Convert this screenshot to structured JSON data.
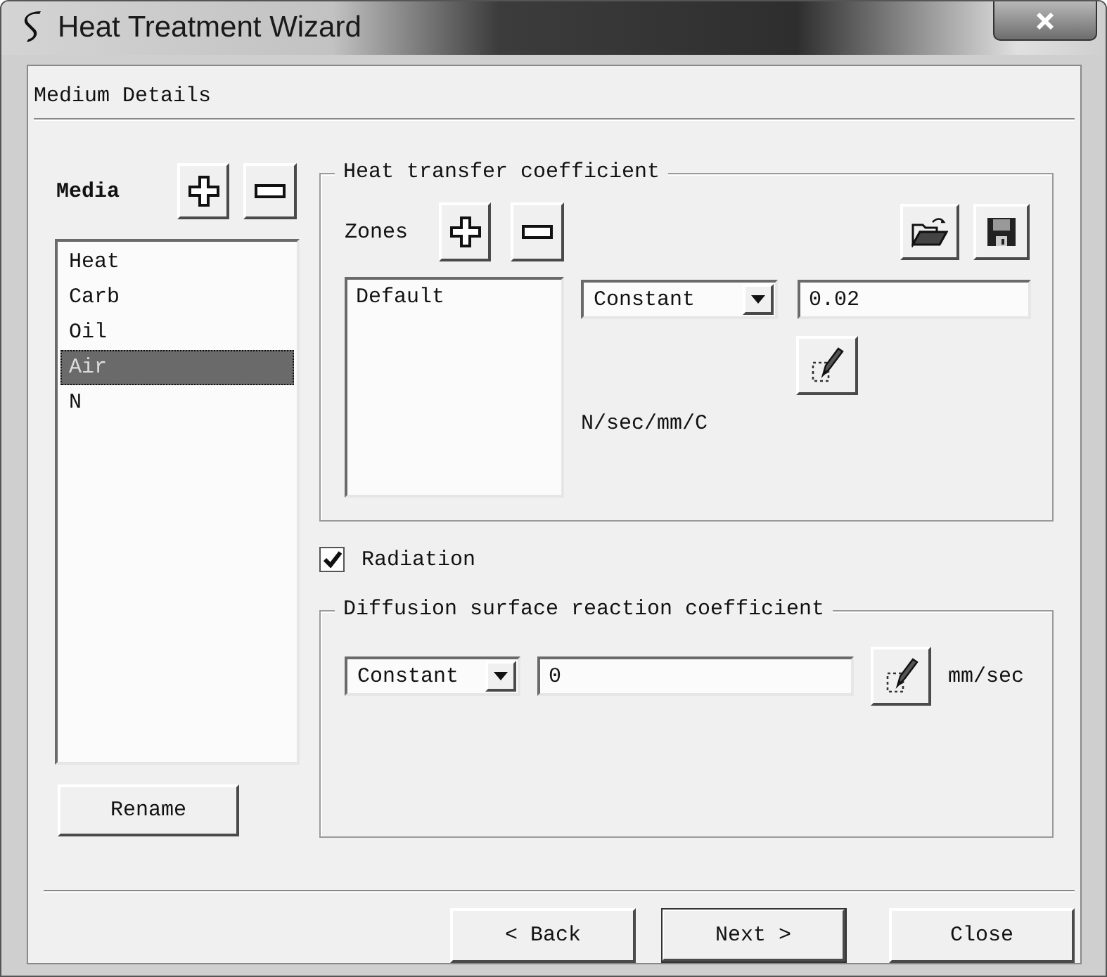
{
  "window": {
    "title": "Heat Treatment Wizard"
  },
  "page_title": "Medium Details",
  "media": {
    "label": "Media",
    "items": [
      {
        "label": "Heat",
        "selected": false
      },
      {
        "label": "Carb",
        "selected": false
      },
      {
        "label": "Oil",
        "selected": false
      },
      {
        "label": "Air",
        "selected": true
      },
      {
        "label": "N",
        "selected": false
      }
    ],
    "rename": "Rename"
  },
  "heat_transfer": {
    "title": "Heat transfer coefficient",
    "zones_label": "Zones",
    "zones": [
      {
        "label": "Default",
        "selected": false
      }
    ],
    "mode": "Constant",
    "value": "0.02",
    "unit": "N/sec/mm/C"
  },
  "radiation": {
    "label": "Radiation",
    "checked": true
  },
  "diffusion": {
    "title": "Diffusion surface reaction coefficient",
    "mode": "Constant",
    "value": "0",
    "unit": "mm/sec"
  },
  "buttons": [
    {
      "label": "< Back",
      "default": false
    },
    {
      "label": "Next >",
      "default": true
    },
    {
      "label": "Close",
      "default": false
    }
  ]
}
